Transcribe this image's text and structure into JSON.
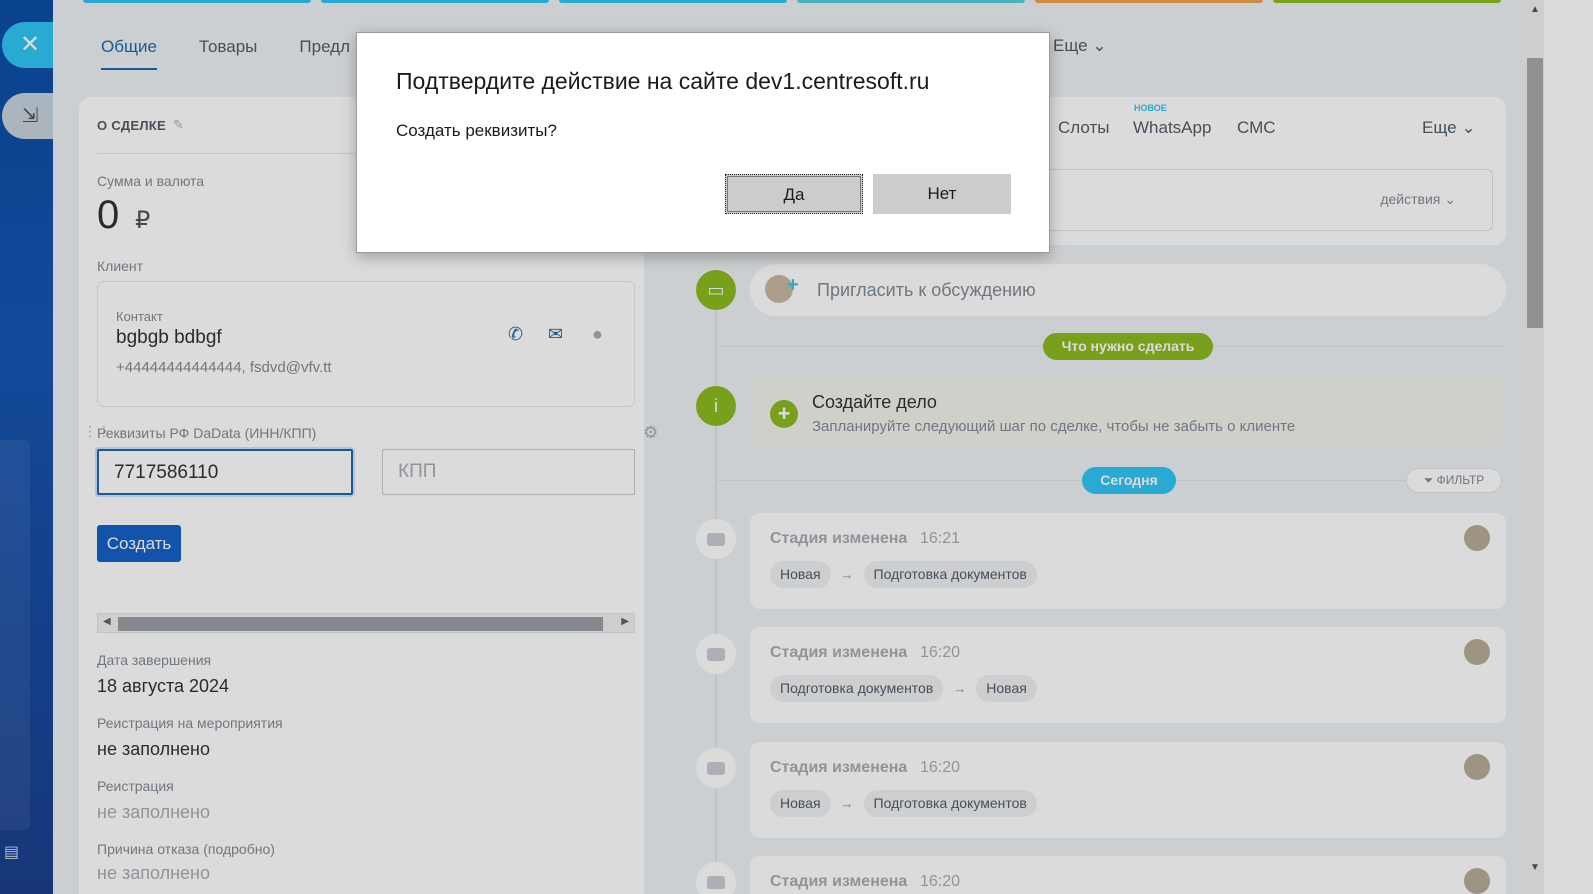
{
  "tabs": [
    "Общие",
    "Товары",
    "Предл"
  ],
  "tab_more": "Еще ⌄",
  "deal": {
    "section_title": "О СДЕЛКЕ",
    "sum_label": "Сумма и валюта",
    "sum_value": "0",
    "currency": "₽",
    "client_label": "Клиент",
    "contact_label": "Контакт",
    "contact_name": "bgbgb bdbgf",
    "contact_info": "+44444444444444, fsdvd@vfv.tt",
    "req_label": "Реквизиты РФ DaData (ИНН/КПП)",
    "inn_value": "7717586110",
    "kpp_placeholder": "КПП",
    "create_label": "Создать",
    "fields": [
      {
        "label": "Дата завершения",
        "value": "18 августа 2024"
      },
      {
        "label": "Реиcтрация на мероприятия",
        "value": "не заполнено"
      },
      {
        "label": "Реиcтрация",
        "value": "не заполнено"
      },
      {
        "label": "Причина отказа (подробно)",
        "value": "не заполнено"
      }
    ]
  },
  "activity": {
    "tabs": [
      "Слоты",
      "WhatsApp",
      "СМС"
    ],
    "new_badge": "НОВОЕ",
    "more": "Еще ⌄",
    "actions": "действия ⌄"
  },
  "timeline": {
    "discuss": "Пригласить к обсуждению",
    "todo_pill": "Что нужно сделать",
    "todo_title": "Создайте дело",
    "todo_text": "Запланируйте следующий шаг по сделке, чтобы не забыть о клиенте",
    "today_pill": "Сегодня",
    "filter": "ФИЛЬТР",
    "events": [
      {
        "title": "Стадия изменена",
        "time": "16:21",
        "from": "Новая",
        "to": "Подготовка документов"
      },
      {
        "title": "Стадия изменена",
        "time": "16:20",
        "from": "Подготовка документов",
        "to": "Новая"
      },
      {
        "title": "Стадия изменена",
        "time": "16:20",
        "from": "Новая",
        "to": "Подготовка документов"
      },
      {
        "title": "Стадия изменена",
        "time": "16:20",
        "from": "",
        "to": ""
      }
    ]
  },
  "dialog": {
    "title": "Подтвердите действие на сайте dev1.centresoft.ru",
    "message": "Создать реквизиты?",
    "yes": "Да",
    "no": "Нет"
  },
  "colors": {
    "rail": "#0b4da6",
    "accent": "#2067b0",
    "create_btn": "#1661c8",
    "green": "#8dbb1f",
    "today": "#2fc6f6",
    "strips": [
      "#2fc6f6",
      "#2fc6f6",
      "#2fc6f6",
      "#55d0e0",
      "#7bd4c8",
      "#f0a04e",
      "#8dbb1f"
    ]
  }
}
